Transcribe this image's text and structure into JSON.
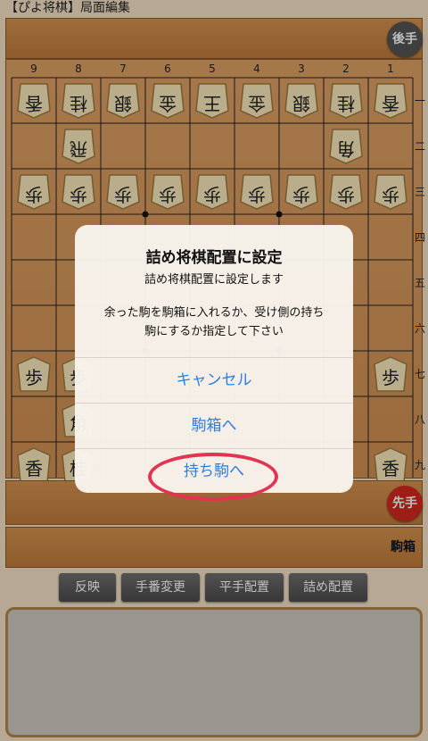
{
  "window": {
    "title": "【ぴよ将棋】局面編集"
  },
  "turn": {
    "gote": "後手",
    "sente": "先手"
  },
  "komabako": "駒箱",
  "board": {
    "columns": [
      "9",
      "8",
      "7",
      "6",
      "5",
      "4",
      "3",
      "2",
      "1"
    ],
    "rows": [
      "一",
      "二",
      "三",
      "四",
      "五",
      "六",
      "七",
      "八",
      "九"
    ],
    "pieces": [
      {
        "col": 9,
        "row": 1,
        "ch": "香",
        "side": "gote"
      },
      {
        "col": 8,
        "row": 1,
        "ch": "桂",
        "side": "gote"
      },
      {
        "col": 7,
        "row": 1,
        "ch": "銀",
        "side": "gote"
      },
      {
        "col": 6,
        "row": 1,
        "ch": "金",
        "side": "gote"
      },
      {
        "col": 5,
        "row": 1,
        "ch": "王",
        "side": "gote"
      },
      {
        "col": 4,
        "row": 1,
        "ch": "金",
        "side": "gote"
      },
      {
        "col": 3,
        "row": 1,
        "ch": "銀",
        "side": "gote"
      },
      {
        "col": 2,
        "row": 1,
        "ch": "桂",
        "side": "gote"
      },
      {
        "col": 1,
        "row": 1,
        "ch": "香",
        "side": "gote"
      },
      {
        "col": 8,
        "row": 2,
        "ch": "飛",
        "side": "gote"
      },
      {
        "col": 2,
        "row": 2,
        "ch": "角",
        "side": "gote"
      },
      {
        "col": 9,
        "row": 3,
        "ch": "歩",
        "side": "gote"
      },
      {
        "col": 8,
        "row": 3,
        "ch": "歩",
        "side": "gote"
      },
      {
        "col": 7,
        "row": 3,
        "ch": "歩",
        "side": "gote"
      },
      {
        "col": 6,
        "row": 3,
        "ch": "歩",
        "side": "gote"
      },
      {
        "col": 5,
        "row": 3,
        "ch": "歩",
        "side": "gote"
      },
      {
        "col": 4,
        "row": 3,
        "ch": "歩",
        "side": "gote"
      },
      {
        "col": 3,
        "row": 3,
        "ch": "歩",
        "side": "gote"
      },
      {
        "col": 2,
        "row": 3,
        "ch": "歩",
        "side": "gote"
      },
      {
        "col": 1,
        "row": 3,
        "ch": "歩",
        "side": "gote"
      },
      {
        "col": 9,
        "row": 7,
        "ch": "歩",
        "side": "sente"
      },
      {
        "col": 8,
        "row": 7,
        "ch": "歩",
        "side": "sente"
      },
      {
        "col": 1,
        "row": 7,
        "ch": "歩",
        "side": "sente"
      },
      {
        "col": 8,
        "row": 8,
        "ch": "角",
        "side": "sente"
      },
      {
        "col": 9,
        "row": 9,
        "ch": "香",
        "side": "sente"
      },
      {
        "col": 8,
        "row": 9,
        "ch": "桂",
        "side": "sente"
      },
      {
        "col": 1,
        "row": 9,
        "ch": "香",
        "side": "sente"
      }
    ]
  },
  "buttons": {
    "hanei": "反映",
    "teban": "手番変更",
    "hirate": "平手配置",
    "tsume": "詰め配置"
  },
  "dialog": {
    "title": "詰め将棋配置に設定",
    "subtitle": "詰め将棋配置に設定します",
    "message_line1": "余った駒を駒箱に入れるか、受け側の持ち",
    "message_line2": "駒にするか指定して下さい",
    "cancel": "キャンセル",
    "to_box": "駒箱へ",
    "to_hand": "持ち駒へ"
  },
  "colors": {
    "accent": "#2f7de0",
    "highlight": "#e23352",
    "sente": "#d0281f",
    "gote": "#555555"
  }
}
